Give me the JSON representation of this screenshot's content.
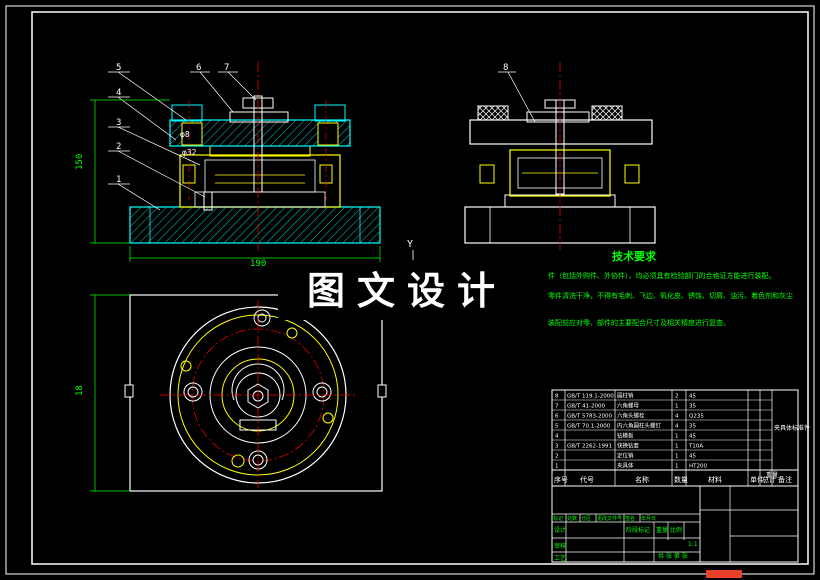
{
  "drawing": {
    "part_numbers": [
      "5",
      "4",
      "3",
      "2",
      "1",
      "6",
      "7",
      "8"
    ],
    "dim_height": "150",
    "dim_width": "190",
    "dim_plan": "18",
    "dim_hole": "φ8",
    "dim_bore": "φ32",
    "axis_label": "Y"
  },
  "tech_req": {
    "title": "技术要求",
    "line1": "件（包括外购件、外协件），均必须具有检验部门的合格证方能进行装配。",
    "line2": "零件清洗干净，不得有毛刺、飞边、氧化皮、锈蚀、切屑、油污、着色剂和灰尘",
    "line3": "装配前应对零、部件的主要配合尺寸及相关精度进行复查。"
  },
  "watermark": "图文设计",
  "bom": {
    "rows": [
      [
        "8",
        "GB/T 119.1-2000",
        "圆柱销",
        "2",
        "45",
        ""
      ],
      [
        "7",
        "GB/T 41-2000",
        "六角螺母",
        "1",
        "35",
        ""
      ],
      [
        "6",
        "GB/T 5783-2000",
        "六角头螺栓",
        "4",
        "Q235",
        ""
      ],
      [
        "5",
        "GB/T 70.1-2000",
        "内六角圆柱头螺钉",
        "4",
        "35",
        ""
      ],
      [
        "4",
        "",
        "钻模板",
        "1",
        "45",
        ""
      ],
      [
        "3",
        "GB/T 2262-1991",
        "快换钻套",
        "1",
        "T10A",
        ""
      ],
      [
        "2",
        "",
        "定位销",
        "1",
        "45",
        ""
      ],
      [
        "1",
        "",
        "夹具体",
        "1",
        "HT200",
        ""
      ]
    ],
    "side_note": "夹具体标准件",
    "header": [
      "序号",
      "代号",
      "名称",
      "数量",
      "材料",
      "单件",
      "总计",
      "备注"
    ],
    "header_weight": "重量"
  },
  "title_block": {
    "labels": [
      "标记",
      "处数",
      "分区",
      "更改文件号",
      "签名",
      "年月日"
    ],
    "row_labels": [
      "设计",
      "审核",
      "工艺"
    ],
    "stage_label": "阶段标记",
    "weight_label": "重量",
    "scale_label": "比例",
    "scale_value": "1:1",
    "sheet_label": "共 张 第 张"
  },
  "colors": {
    "frame": "#ffffff",
    "part": "#ffff00",
    "outline": "#00ffff",
    "hatch": "#00ffff",
    "dim": "#00ff00",
    "center": "#ff0000",
    "hidden": "#ff00ff",
    "text_green": "#00ff00",
    "table": "#ffffff"
  }
}
